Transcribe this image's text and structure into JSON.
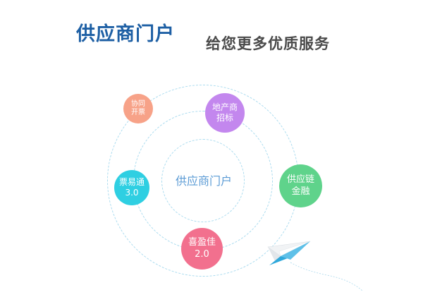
{
  "header": {
    "title": "供应商门户",
    "subtitle": "给您更多优质服务"
  },
  "diagram": {
    "center_label": "供应商门户",
    "nodes": [
      {
        "id": "cooperative-invoicing",
        "line1": "协同",
        "line2": "开票",
        "color": "#f7a288"
      },
      {
        "id": "real-estate-bidding",
        "line1": "地产商",
        "line2": "招标",
        "color": "#c387ee"
      },
      {
        "id": "supply-chain-finance",
        "line1": "供应链",
        "line2": "金融",
        "color": "#5fd38b"
      },
      {
        "id": "piaoyitong",
        "line1": "票易通",
        "line2": "3.0",
        "color": "#2fcfe2"
      },
      {
        "id": "xiyingjia",
        "line1": "喜盈佳",
        "line2": "2.0",
        "color": "#f2708e"
      }
    ],
    "colors": {
      "ring": "#a9dbef",
      "center_text": "#5b9bd5",
      "title": "#1d5fa4",
      "subtitle": "#4a4a4a",
      "plane_blue": "#2fa8db"
    },
    "decoration": "paper-plane-icon"
  }
}
